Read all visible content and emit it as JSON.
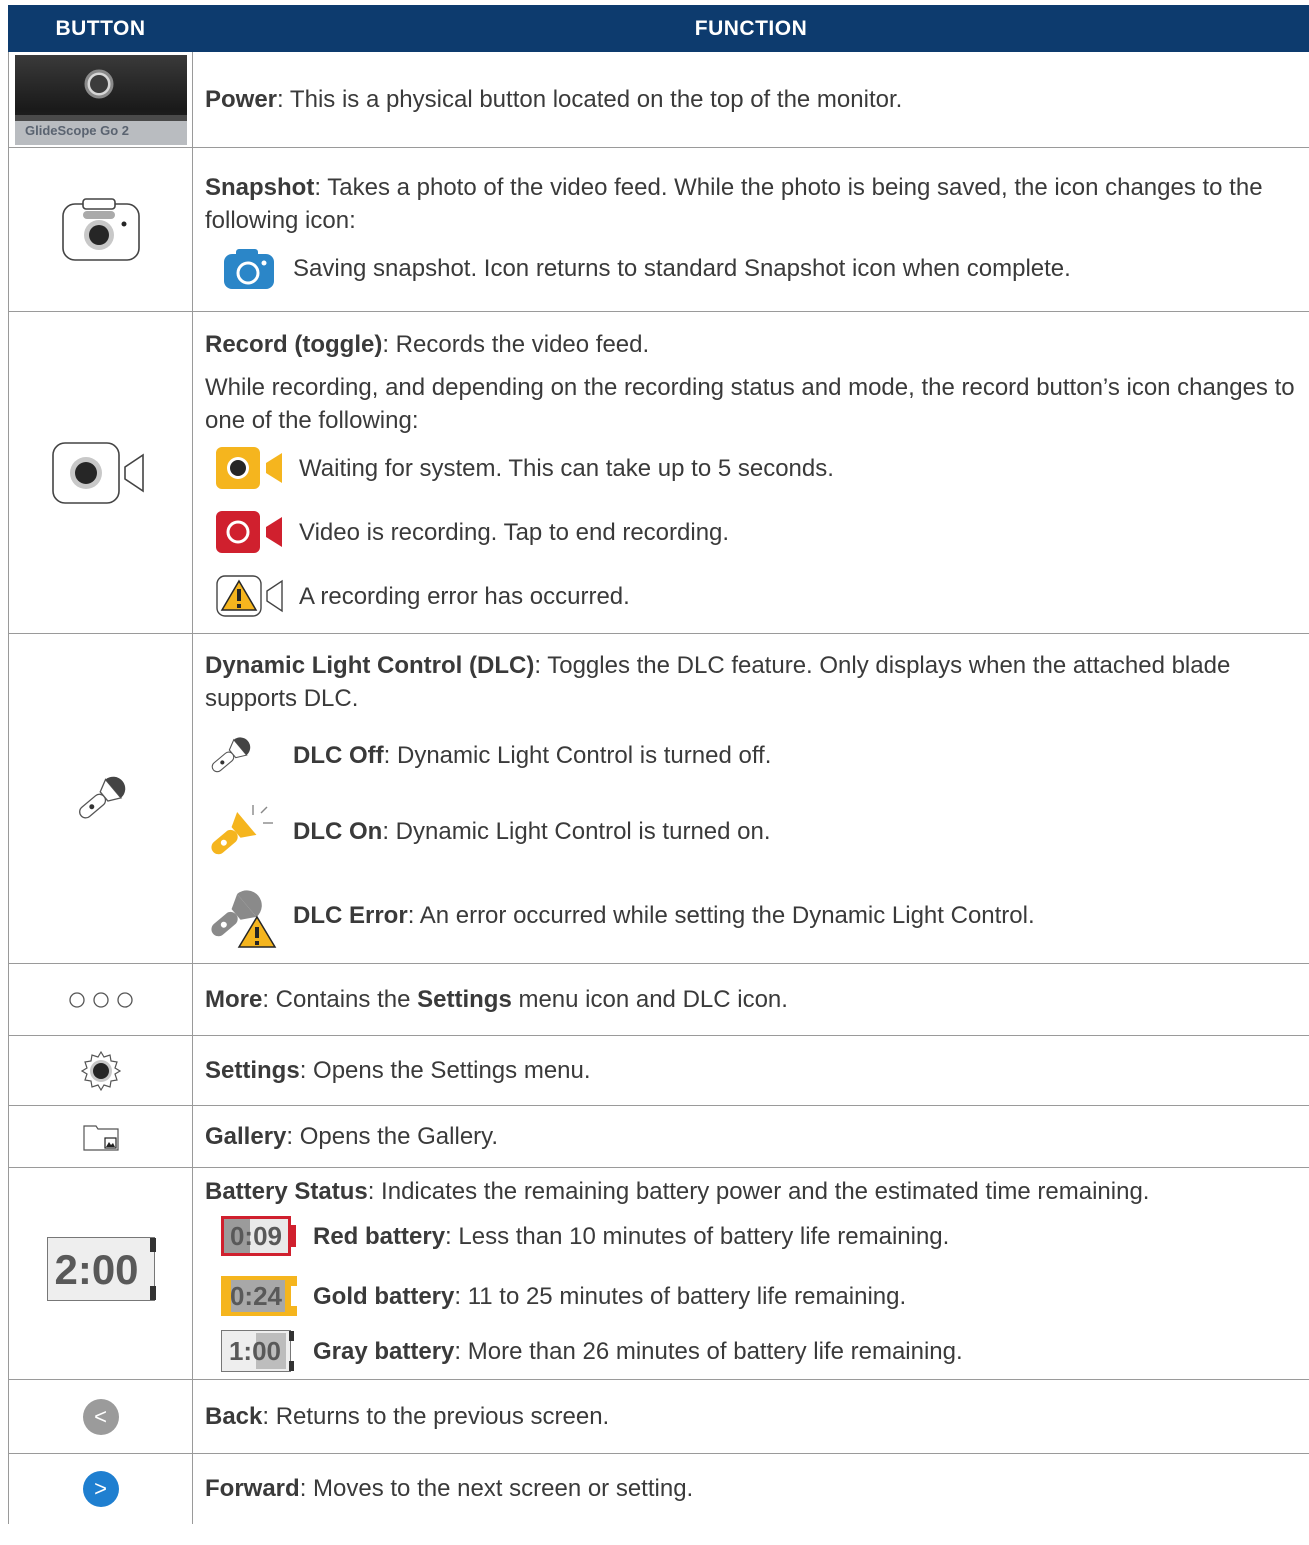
{
  "table": {
    "header": {
      "col1": "BUTTON",
      "col2": "FUNCTION"
    },
    "rows": {
      "power": {
        "photo_text": "GlideScope Go 2",
        "label": "Power",
        "text": ": This is a physical button located on the top of the monitor."
      },
      "snapshot": {
        "label": "Snapshot",
        "text": ": Takes a photo of the video feed. While the photo is being saved, the icon changes to the following icon:",
        "saving": "Saving snapshot. Icon returns to standard Snapshot icon when complete."
      },
      "record": {
        "label": "Record (toggle)",
        "text": ": Records the video feed.",
        "text2": "While recording, and depending on the recording status and mode, the record button’s icon changes to one of the following:",
        "waiting": "Waiting for system. This can take up to 5 seconds.",
        "recording": "Video is recording. Tap to end recording.",
        "error": "A recording error has occurred."
      },
      "dlc": {
        "label": "Dynamic Light Control (DLC)",
        "text": ": Toggles the DLC feature. Only displays when the attached blade supports DLC.",
        "off_label": "DLC Off",
        "off_text": ": Dynamic Light Control is turned off.",
        "on_label": "DLC On",
        "on_text": ": Dynamic Light Control is turned on.",
        "error_label": "DLC Error",
        "error_text": ": An error occurred while setting the Dynamic Light Control."
      },
      "more": {
        "label": "More",
        "text_a": ": Contains the ",
        "settings_word": "Settings",
        "text_b": " menu icon and DLC icon."
      },
      "settings": {
        "label": "Settings",
        "text": ": Opens the Settings menu."
      },
      "gallery": {
        "label": "Gallery",
        "text": ": Opens the Gallery."
      },
      "battery": {
        "icon_time": "2:00",
        "label": "Battery Status",
        "text": ": Indicates the remaining battery power and the estimated time remaining.",
        "red_time": "0:09",
        "red_label": "Red battery",
        "red_text": ": Less than 10 minutes of battery life remaining.",
        "gold_time": "0:24",
        "gold_label": "Gold battery",
        "gold_text": ": 11 to 25 minutes of battery life remaining.",
        "gray_time": "1:00",
        "gray_label": "Gray battery",
        "gray_text": ": More than 26 minutes of battery life remaining."
      },
      "back": {
        "glyph": "<",
        "label": "Back",
        "text": ": Returns to the previous screen."
      },
      "forward": {
        "glyph": ">",
        "label": "Forward",
        "text": ": Moves to the next screen or setting."
      }
    }
  },
  "colors": {
    "header_bg": "#0d3b6e",
    "snapshot_blue": "#2b86c8",
    "waiting_gold": "#f5b51e",
    "recording_red": "#d0202e",
    "battery_gray": "#595959",
    "back_gray": "#9b9b9b",
    "forward_blue": "#1f7fd0"
  },
  "icons": {
    "power": "power-button-photo",
    "snapshot": "camera-icon",
    "record": "video-camera-icon",
    "dlc": "flashlight-icon",
    "more": "more-dots-icon",
    "settings": "gear-icon",
    "gallery": "gallery-folder-icon",
    "battery": "battery-icon",
    "back": "back-arrow-icon",
    "forward": "forward-arrow-icon"
  }
}
